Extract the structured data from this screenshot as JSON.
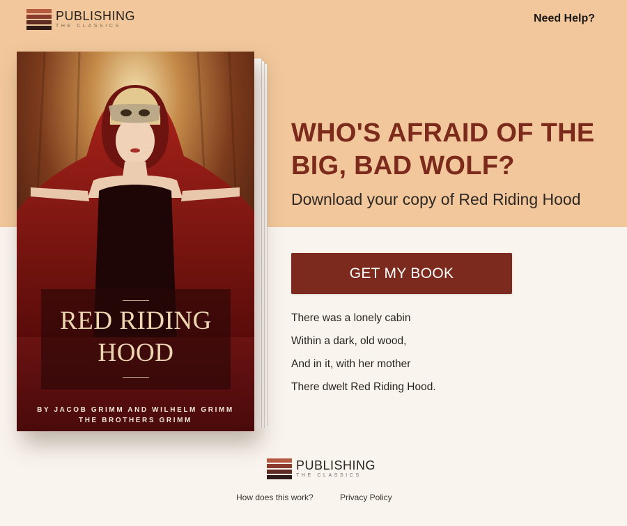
{
  "brand": {
    "name": "PUBLISHING",
    "tagline": "THE CLASSICS",
    "stripe_colors": [
      "#b65a3f",
      "#8a3b2b",
      "#5e2a22",
      "#2e1a17"
    ]
  },
  "header": {
    "help_link": "Need Help?"
  },
  "book": {
    "title_line1": "RED RIDING",
    "title_line2": "HOOD",
    "authors_line1": "BY JACOB GRIMM AND WILHELM GRIMM",
    "authors_line2": "THE BROTHERS GRIMM"
  },
  "hero": {
    "headline_line1": "WHO'S AFRAID OF THE",
    "headline_line2": "BIG, BAD WOLF?",
    "subhead": "Download your copy of Red Riding Hood",
    "cta_label": "GET MY BOOK"
  },
  "poem": [
    "There was a lonely cabin",
    "Within a dark, old wood,",
    "And in it, with her mother",
    "There dwelt Red Riding Hood."
  ],
  "footer": {
    "links": [
      "How does this work?",
      "Privacy Policy"
    ]
  },
  "colors": {
    "top_band": "#f1c79b",
    "page_background": "#faf4ee",
    "accent": "#7b2a1c",
    "button": "#7c2a1e"
  }
}
